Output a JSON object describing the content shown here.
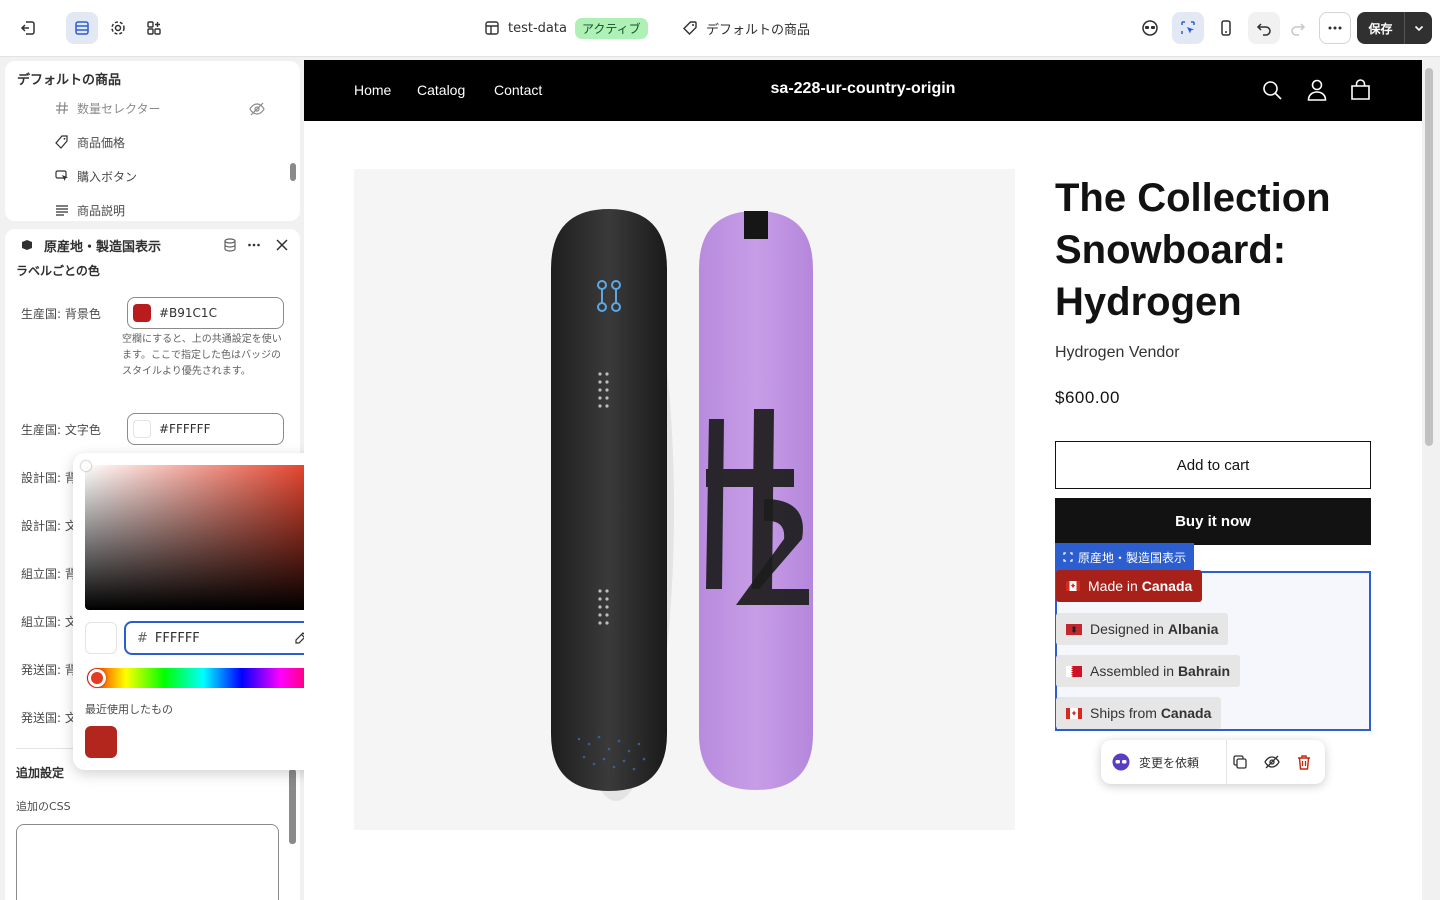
{
  "topbar": {
    "theme_name": "test-data",
    "status": "アクティブ",
    "template": "デフォルトの商品",
    "save": "保存"
  },
  "tree": {
    "title": "デフォルトの商品",
    "items": [
      {
        "label": "数量セレクター",
        "icon": "hash-icon"
      },
      {
        "label": "商品価格",
        "icon": "price-tag-icon"
      },
      {
        "label": "購入ボタン",
        "icon": "cursor-button-icon"
      },
      {
        "label": "商品説明",
        "icon": "text-lines-icon"
      }
    ]
  },
  "settings": {
    "section_title": "原産地・製造国表示",
    "group_title": "ラベルごとの色",
    "fields": [
      {
        "label": "生産国: 背景色",
        "value": "#B91C1C",
        "color": "#b91c1c"
      },
      {
        "label": "生産国: 文字色",
        "value": "#FFFFFF",
        "color": "#ffffff"
      },
      {
        "label": "設計国: 背"
      },
      {
        "label": "設計国: 文"
      },
      {
        "label": "組立国: 背"
      },
      {
        "label": "組立国: 文"
      },
      {
        "label": "発送国: 背"
      },
      {
        "label": "発送国: 文"
      }
    ],
    "help_text": "空欄にすると、上の共通設定を使います。ここで指定した色はバッジのスタイルより優先されます。",
    "extra_title": "追加設定",
    "css_label": "追加のCSS"
  },
  "picker": {
    "hash": "#",
    "hex_value": "FFFFFF",
    "recent_label": "最近使用したもの",
    "recent_colors": [
      "#b3261e"
    ],
    "base_hue": "#e33a22"
  },
  "store": {
    "nav": [
      "Home",
      "Catalog",
      "Contact"
    ],
    "shop_name": "sa-228-ur-country-origin",
    "product_title": "The Collection Snowboard: Hydrogen",
    "vendor": "Hydrogen Vendor",
    "price": "$600.00",
    "add_to_cart": "Add to cart",
    "buy_now": "Buy it now",
    "block_tag": "原産地・製造国表示",
    "badges": [
      {
        "prefix": "Made in ",
        "country": "Canada",
        "flag": "canada-flag-icon",
        "bg": "#a8201a",
        "fg": "#ffffff"
      },
      {
        "prefix": "Designed in ",
        "country": "Albania",
        "flag": "albania-flag-icon",
        "bg": "#e6e6e6",
        "fg": "#333333"
      },
      {
        "prefix": "Assembled in ",
        "country": "Bahrain",
        "flag": "bahrain-flag-icon",
        "bg": "#e6e6e6",
        "fg": "#333333"
      },
      {
        "prefix": "Ships from ",
        "country": "Canada",
        "flag": "canada-flag-icon",
        "bg": "#e6e6e6",
        "fg": "#333333"
      }
    ],
    "request_change": "変更を依頼"
  }
}
